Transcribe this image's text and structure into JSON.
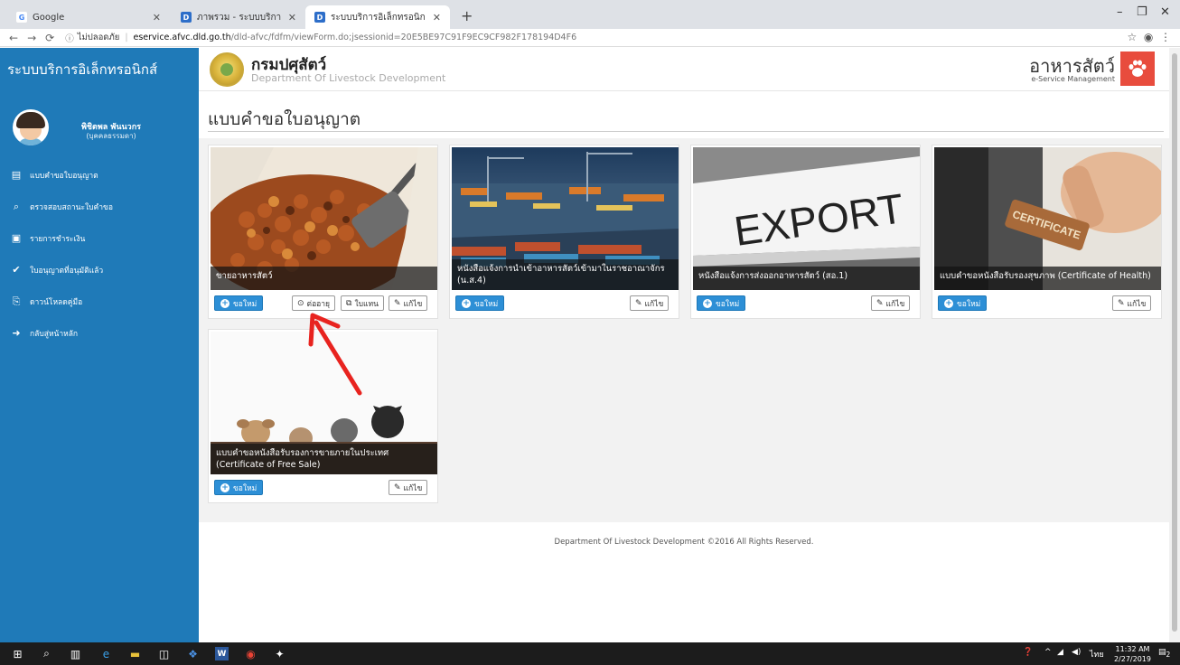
{
  "browser": {
    "tabs": [
      {
        "label": "Google",
        "favicon": "G"
      },
      {
        "label": "ภาพรวม - ระบบบริการอิเล็กทรอนิกส์",
        "favicon": "D"
      },
      {
        "label": "ระบบบริการอิเล็กทรอนิกส์",
        "favicon": "D"
      }
    ],
    "new_tab": "+",
    "url_security": "ไม่ปลอดภัย",
    "url_host": "eservice.afvc.dld.go.th",
    "url_path": "/dld-afvc/fdfm/viewForm.do;jsessionid=20E5BE97C91F9EC9CF982F178194D4F6"
  },
  "header": {
    "system_name": "ระบบบริการอิเล็กทรอนิกส์",
    "org_th": "กรมปศุสัตว์",
    "org_en": "Department Of Livestock Development",
    "service_title": "อาหารสัตว์",
    "service_sub": "e-Service Management"
  },
  "user": {
    "name": "พิชิตพล พันนวกร",
    "role": "(บุคคลธรรมดา)"
  },
  "menu": [
    {
      "icon": "document-icon",
      "glyph": "▤",
      "label": "แบบคำขอใบอนุญาต"
    },
    {
      "icon": "search-icon",
      "glyph": "⌕",
      "label": "ตรวจสอบสถานะใบคำขอ"
    },
    {
      "icon": "cart-icon",
      "glyph": "▣",
      "label": "รายการชำระเงิน"
    },
    {
      "icon": "check-circle-icon",
      "glyph": "✔",
      "label": "ใบอนุญาตที่อนุมัติแล้ว"
    },
    {
      "icon": "pdf-icon",
      "glyph": "⎘",
      "label": "ดาวน์โหลดคู่มือ"
    },
    {
      "icon": "signout-icon",
      "glyph": "➜",
      "label": "กลับสู่หน้าหลัก"
    }
  ],
  "page_title": "แบบคำขอใบอนุญาต",
  "cards": [
    {
      "caption": "ขายอาหารสัตว์",
      "new": "ขอใหม่",
      "renew": "ต่ออายุ",
      "substitute": "ใบแทน",
      "edit": "แก้ไข"
    },
    {
      "caption": "หนังสือแจ้งการนำเข้าอาหารสัตว์เข้ามาในราชอาณาจักร (น.ส.4)",
      "new": "ขอใหม่",
      "edit": "แก้ไข"
    },
    {
      "caption": "หนังสือแจ้งการส่งออกอาหารสัตว์ (สอ.1)",
      "new": "ขอใหม่",
      "edit": "แก้ไข",
      "image_text": "EXPORT"
    },
    {
      "caption": "แบบคำขอหนังสือรับรองสุขภาพ (Certificate of Health)",
      "new": "ขอใหม่",
      "edit": "แก้ไข",
      "image_text": "CERTIFICATE"
    },
    {
      "caption": "แบบคำขอหนังสือรับรองการขายภายในประเทศ (Certificate of Free Sale)",
      "new": "ขอใหม่",
      "edit": "แก้ไข"
    }
  ],
  "footer": "Department Of Livestock Development ©2016 All Rights Reserved.",
  "taskbar": {
    "time": "11:32 AM",
    "date": "2/27/2019",
    "lang": "ไทย",
    "notifications": "2"
  },
  "colors": {
    "sidebar": "#1f7ab8",
    "primary_button": "#2d8fd6",
    "brand_red": "#e84c3d",
    "annotation_arrow": "#e8231f"
  }
}
